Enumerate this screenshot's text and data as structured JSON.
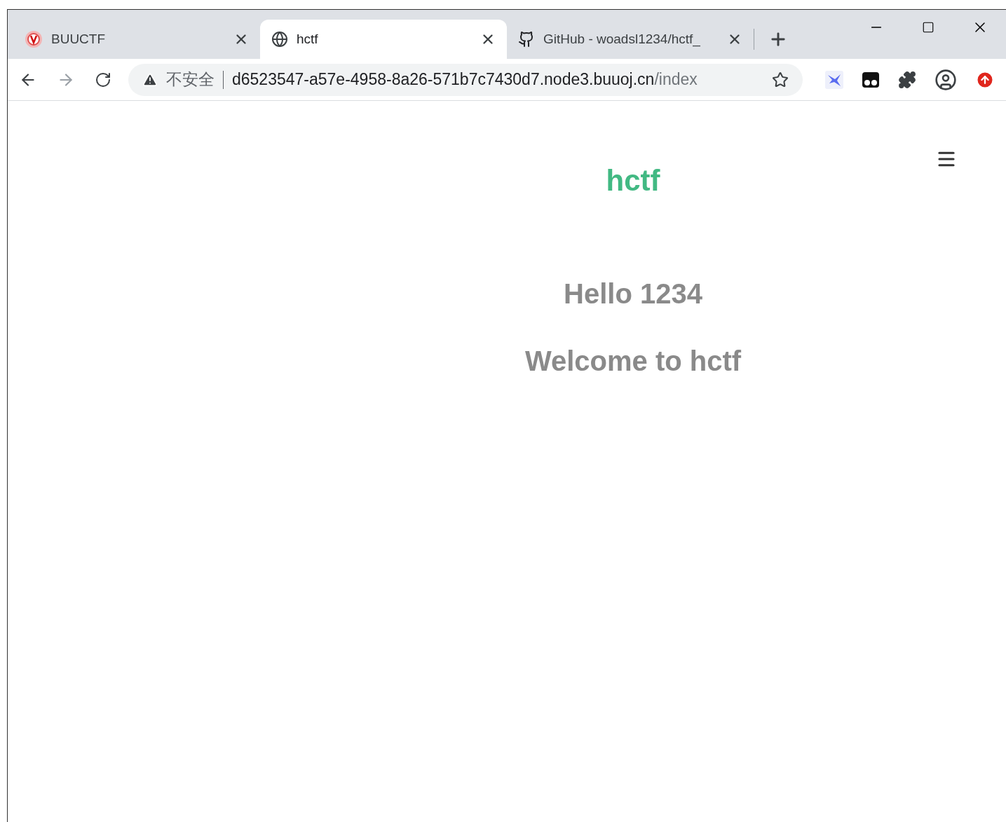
{
  "tabs": [
    {
      "title": "BUUCTF",
      "selected": false,
      "kind": "badge"
    },
    {
      "title": "hctf",
      "selected": true,
      "kind": "globe"
    },
    {
      "title": "GitHub - woadsl1234/hctf_",
      "selected": false,
      "kind": "github"
    }
  ],
  "address_bar": {
    "security": "不安全",
    "host": "d6523547-a57e-4958-8a26-571b7c7430d7.node3.buuoj.cn",
    "path": "/index"
  },
  "page": {
    "brand": "hctf",
    "greeting": "Hello 1234",
    "welcome": "Welcome to hctf"
  }
}
